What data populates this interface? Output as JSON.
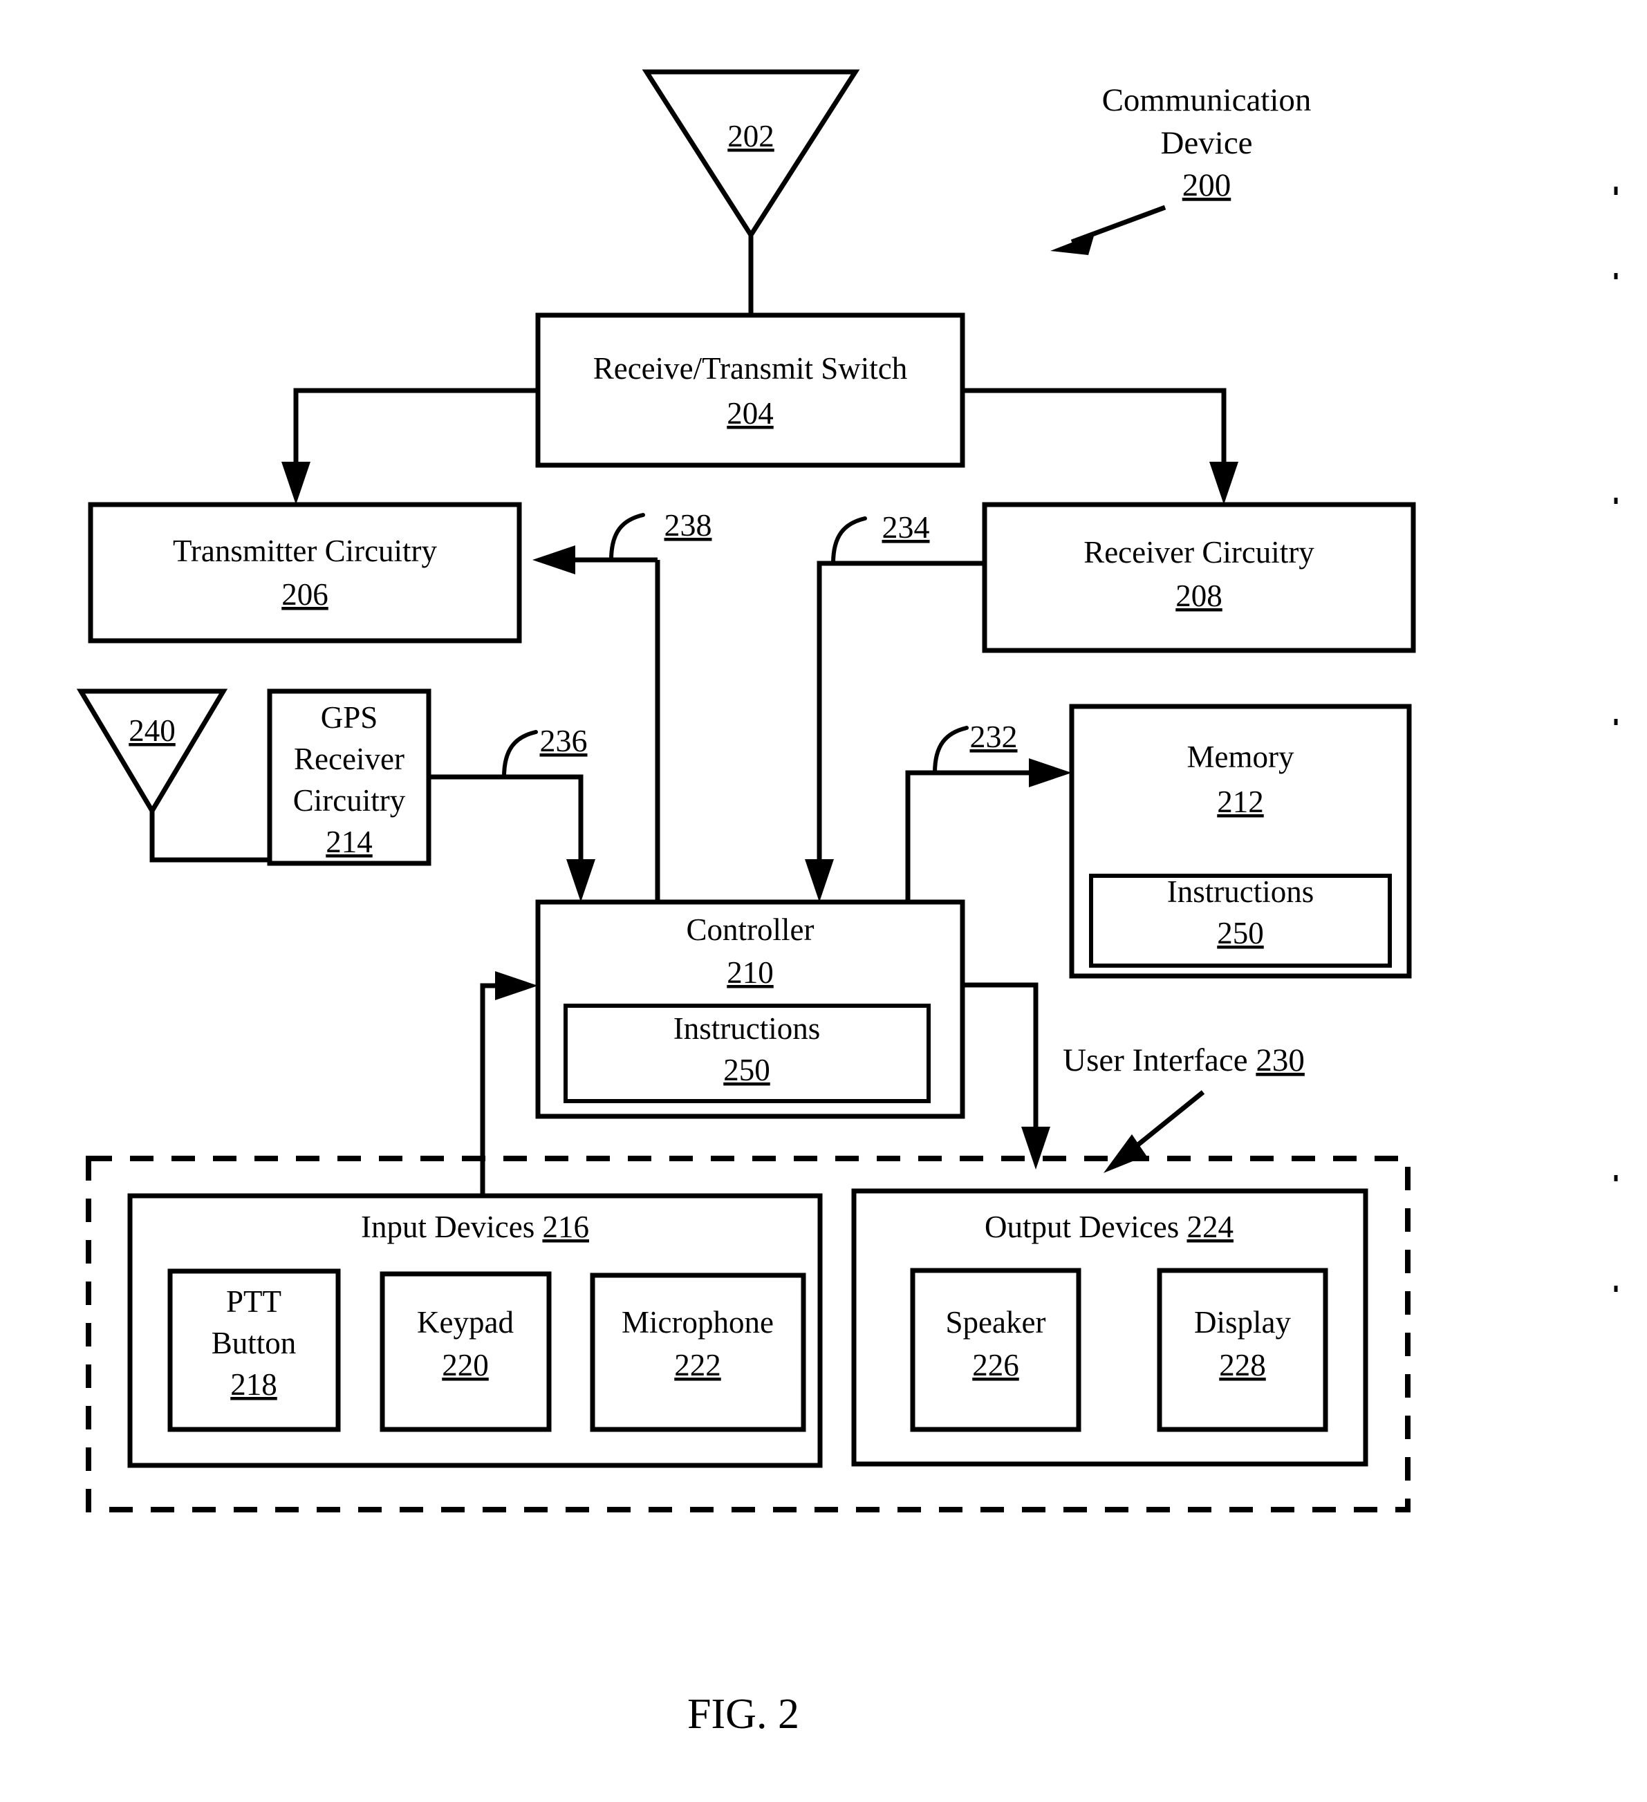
{
  "figure": {
    "caption": "FIG. 2",
    "title_callout": {
      "line1": "Communication",
      "line2": "Device",
      "number": "200"
    },
    "ui_callout": {
      "label": "User Interface",
      "number": "230"
    }
  },
  "nodes": {
    "antenna_main": {
      "number": "202"
    },
    "switch": {
      "label": "Receive/Transmit Switch",
      "number": "204"
    },
    "transmitter": {
      "label": "Transmitter Circuitry",
      "number": "206"
    },
    "receiver": {
      "label": "Receiver Circuitry",
      "number": "208"
    },
    "gps_antenna": {
      "number": "240"
    },
    "gps_receiver": {
      "line1": "GPS",
      "line2": "Receiver",
      "line3": "Circuitry",
      "number": "214"
    },
    "controller": {
      "label": "Controller",
      "number": "210"
    },
    "controller_instructions": {
      "label": "Instructions",
      "number": "250"
    },
    "memory": {
      "label": "Memory",
      "number": "212"
    },
    "memory_instructions": {
      "label": "Instructions",
      "number": "250"
    },
    "input_devices": {
      "label": "Input Devices",
      "number": "216"
    },
    "ptt_button": {
      "line1": "PTT",
      "line2": "Button",
      "number": "218"
    },
    "keypad": {
      "label": "Keypad",
      "number": "220"
    },
    "microphone": {
      "label": "Microphone",
      "number": "222"
    },
    "output_devices": {
      "label": "Output Devices",
      "number": "224"
    },
    "speaker": {
      "label": "Speaker",
      "number": "226"
    },
    "display": {
      "label": "Display",
      "number": "228"
    }
  },
  "connector_refs": {
    "ref_238": "238",
    "ref_234": "234",
    "ref_236": "236",
    "ref_232": "232"
  },
  "colors": {
    "ink": "#000000",
    "paper": "#ffffff"
  }
}
